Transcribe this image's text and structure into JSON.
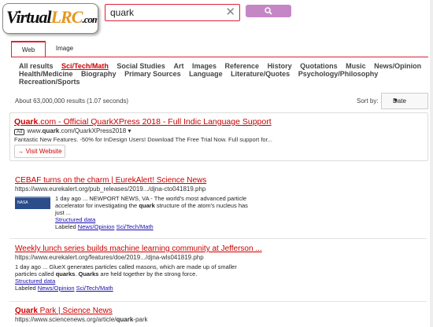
{
  "logo": {
    "part1": "Virtual",
    "part2": "LRC",
    "part3": ".com"
  },
  "search": {
    "value": "quark",
    "clear_icon": "close-icon",
    "button_icon": "search-icon"
  },
  "tabs": [
    {
      "label": "Web",
      "active": true
    },
    {
      "label": "Image",
      "active": false
    }
  ],
  "categories": [
    "All results",
    "Sci/Tech/Math",
    "Social Studies",
    "Art",
    "Images",
    "Reference",
    "History",
    "Quotations",
    "Music",
    "News/Opinion",
    "Health/Medicine",
    "Biography",
    "Primary Sources",
    "Language",
    "Literature/Quotes",
    "Psychology/Philosophy",
    "Recreation/Sports"
  ],
  "active_category": "Sci/Tech/Math",
  "results_meta": "About 63,000,000 results (1.07 seconds)",
  "sort": {
    "label": "Sort by:",
    "value": "Date"
  },
  "ad": {
    "title_bold": "Quark",
    "title_rest": ".com - Official QuarkXPress 2018 - Full Indic Language Support",
    "badge": "Ad",
    "url_prefix": "www.",
    "url_bold": "quark",
    "url_rest": ".com/QuarkXPress2018",
    "url_arrow": "▾",
    "desc": "Fantastic New Features. -50% for InDesign Users! Download The Free Trial Now. Full support for...",
    "visit_label": "Visit Website"
  },
  "results": [
    {
      "title": "CEBAF turns on the charm | EurekAlert! Science News",
      "url": "https://www.eurekalert.org/pub_releases/2019.../djna-cto041819.php",
      "thumb_text": "NASA",
      "snippet_1": "1 day ago ... NEWPORT NEWS, VA - The world's most advanced particle",
      "snippet_2": "accelerator for investigating the quark structure of the atom's nucleus has",
      "snippet_3": "just ...",
      "structured": "Structured data",
      "labeled": "Labeled",
      "label_1": "News/Opinion",
      "label_2": "Sci/Tech/Math"
    },
    {
      "title": "Weekly lunch series builds machine learning community at Jefferson ...",
      "url": "https://www.eurekalert.org/features/doe/2019.../djna-wls041819.php",
      "snippet_1": "1 day ago ... GlueX generates particles called masons, which are made up of smaller",
      "snippet_2": "particles called quarks. Quarks are held together by the strong force.",
      "structured": "Structured data",
      "labeled": "Labeled",
      "label_1": "News/Opinion",
      "label_2": "Sci/Tech/Math"
    },
    {
      "title_bold": "Quark",
      "title_rest": " Park | Science News",
      "url_prefix": "https://www.sciencenews.org/article/",
      "url_bold": "quark",
      "url_rest": "-park"
    }
  ],
  "colors": {
    "accent": "#cc2233",
    "button": "#c586c6",
    "link_red": "#cc0000"
  }
}
